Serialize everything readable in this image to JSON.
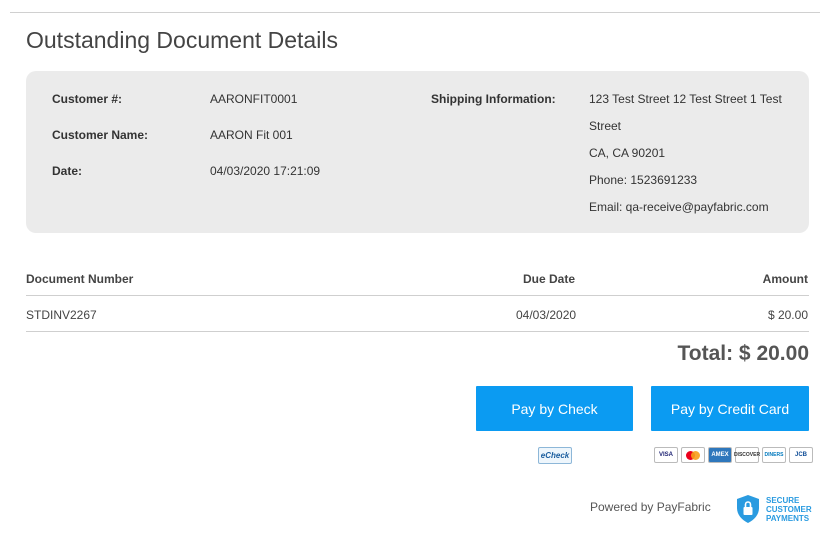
{
  "page": {
    "title": "Outstanding Document Details"
  },
  "customer": {
    "number_label": "Customer #:",
    "number": "AARONFIT0001",
    "name_label": "Customer Name:",
    "name": "AARON Fit 001",
    "date_label": "Date:",
    "date": "04/03/2020 17:21:09"
  },
  "shipping": {
    "label": "Shipping Information:",
    "line1": "123 Test Street 12 Test Street 1 Test",
    "line2": "Street",
    "line3": "CA, CA 90201",
    "phone": "Phone: 1523691233",
    "email": "Email: qa-receive@payfabric.com"
  },
  "table": {
    "headers": {
      "document": "Document Number",
      "due": "Due Date",
      "amount": "Amount"
    },
    "rows": [
      {
        "document": "STDINV2267",
        "due": "04/03/2020",
        "amount": "$ 20.00"
      }
    ]
  },
  "total": "Total: $ 20.00",
  "buttons": {
    "check": "Pay by Check",
    "card": "Pay by Credit Card"
  },
  "payment_icons": {
    "echeck": "eCheck",
    "cards": [
      "VISA",
      "MC",
      "AMEX",
      "DISCOVER",
      "DINERS",
      "JCB"
    ]
  },
  "footer": {
    "powered": "Powered by PayFabric",
    "secure_line1": "SECURE",
    "secure_line2": "CUSTOMER",
    "secure_line3": "PAYMENTS"
  },
  "colors": {
    "accent": "#0b9bf2",
    "card_bg": "#ebebeb"
  }
}
